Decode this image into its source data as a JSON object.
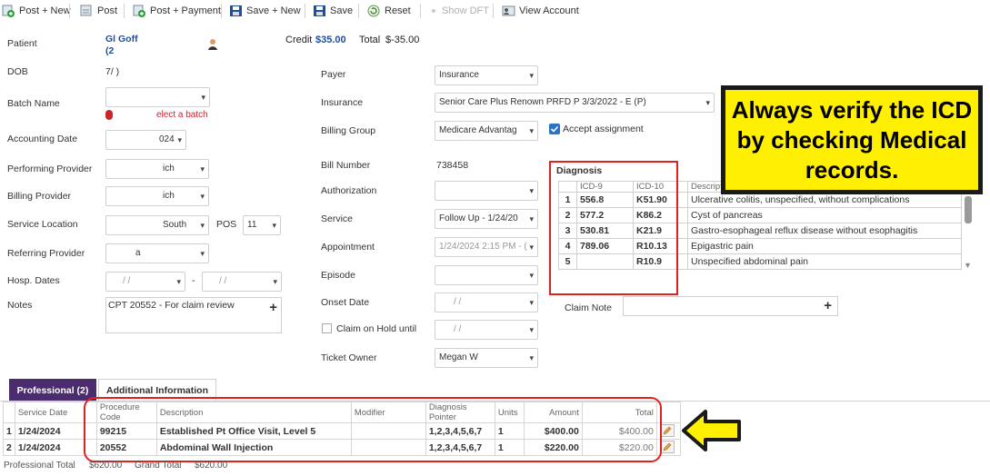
{
  "toolbar": {
    "post_new": "Post + New",
    "post": "Post",
    "post_payment": "Post + Payment",
    "save_new": "Save + New",
    "save": "Save",
    "reset": "Reset",
    "show_dft": "Show DFT",
    "view_account": "View Account"
  },
  "header": {
    "patient_label": "Patient",
    "patient_name": "Gl        Goff",
    "patient_sub": "(2",
    "credit_label": "Credit",
    "credit_value": "$35.00",
    "total_label": "Total",
    "total_value": "$-35.00"
  },
  "left_form": {
    "dob_label": "DOB",
    "dob_value": "7/          )",
    "batch_label": "Batch Name",
    "batch_error": "elect a batch",
    "accounting_label": "Accounting Date",
    "accounting_value": "024",
    "performing_label": "Performing Provider",
    "performing_value": "ich",
    "billing_label": "Billing Provider",
    "billing_value": "ich",
    "location_label": "Service Location",
    "location_value": "South",
    "pos_label": "POS",
    "pos_value": "11",
    "referring_label": "Referring Provider",
    "referring_value": "a",
    "hosp_label": "Hosp. Dates",
    "hosp_from": "/    /",
    "hosp_to": "/    /",
    "hosp_sep": "-",
    "notes_label": "Notes",
    "notes_value": "CPT 20552 - For claim review"
  },
  "mid_form": {
    "payer_label": "Payer",
    "payer_value": "Insurance",
    "insurance_label": "Insurance",
    "insurance_value": "Senior Care Plus Renown PRFD P 3/3/2022 - E (P)",
    "billing_group_label": "Billing Group",
    "billing_group_value": "Medicare Advantag",
    "accept_label": "Accept assignment",
    "bill_number_label": "Bill Number",
    "bill_number_value": "738458",
    "authorization_label": "Authorization",
    "service_label": "Service",
    "service_value": "Follow Up - 1/24/20",
    "appointment_label": "Appointment",
    "appointment_value": "1/24/2024 2:15 PM - (",
    "episode_label": "Episode",
    "onset_label": "Onset Date",
    "onset_value": "/    /",
    "hold_label": "Claim on Hold until",
    "hold_value": "/    /",
    "owner_label": "Ticket Owner",
    "owner_value": "Megan W"
  },
  "diagnosis": {
    "title": "Diagnosis",
    "headers": [
      "",
      "ICD-9",
      "ICD-10",
      "Descript"
    ],
    "rows": [
      {
        "n": "1",
        "icd9": "556.8",
        "icd10": "K51.90",
        "desc": "Ulcerative colitis, unspecified, without complications"
      },
      {
        "n": "2",
        "icd9": "577.2",
        "icd10": "K86.2",
        "desc": "Cyst of pancreas"
      },
      {
        "n": "3",
        "icd9": "530.81",
        "icd10": "K21.9",
        "desc": "Gastro-esophageal reflux disease without esophagitis"
      },
      {
        "n": "4",
        "icd9": "789.06",
        "icd10": "R10.13",
        "desc": "Epigastric pain"
      },
      {
        "n": "5",
        "icd9": "",
        "icd10": "R10.9",
        "desc": "Unspecified abdominal pain"
      }
    ]
  },
  "claim_note_label": "Claim Note",
  "callout_text": "Always verify the ICD by checking Medical records.",
  "tabs": {
    "professional": "Professional (2)",
    "additional": "Additional Information"
  },
  "services": {
    "headers": {
      "date": "Service Date",
      "code": "Procedure Code",
      "desc": "Description",
      "modifier": "Modifier",
      "pointer": "Diagnosis Pointer",
      "units": "Units",
      "amount": "Amount",
      "total": "Total"
    },
    "rows": [
      {
        "n": "1",
        "date": "1/24/2024",
        "code": "99215",
        "desc": "Established Pt Office Visit, Level 5",
        "modifier": "",
        "pointer": "1,2,3,4,5,6,7",
        "units": "1",
        "amount": "$400.00",
        "total": "$400.00"
      },
      {
        "n": "2",
        "date": "1/24/2024",
        "code": "20552",
        "desc": "Abdominal Wall Injection",
        "modifier": "",
        "pointer": "1,2,3,4,5,6,7",
        "units": "1",
        "amount": "$220.00",
        "total": "$220.00"
      }
    ]
  },
  "footer": {
    "professional_total_label": "Professional Total",
    "professional_total_value": "$620.00",
    "grand_total_label": "Grand Total",
    "grand_total_value": "$620.00"
  },
  "colors": {
    "tab_active": "#4a2c6f",
    "highlight_red": "#e0221f",
    "callout_yellow": "#ffef00",
    "link_blue": "#1f4e9c"
  }
}
